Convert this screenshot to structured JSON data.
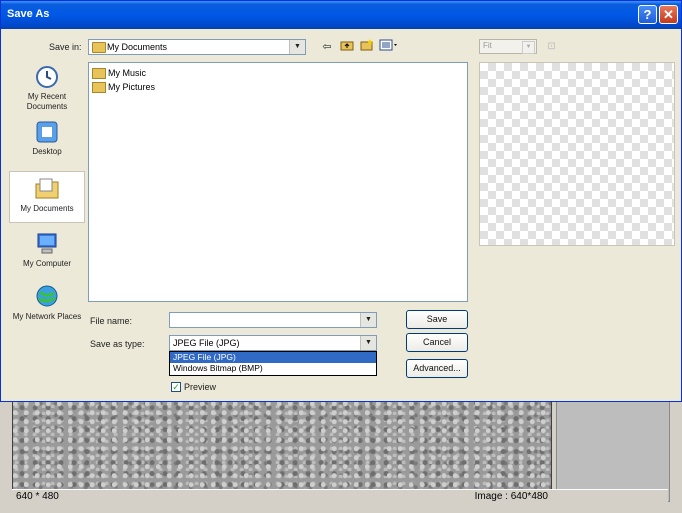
{
  "dialog": {
    "title": "Save As",
    "help_button": "?",
    "close_button": "✕"
  },
  "save_in": {
    "label": "Save in:",
    "value": "My Documents"
  },
  "toolbar": {
    "back_icon": "back-arrow-icon",
    "up_icon": "up-folder-icon",
    "new_folder_icon": "new-folder-icon",
    "views_icon": "views-menu-icon"
  },
  "places": [
    {
      "label": "My Recent Documents",
      "icon": "recent-documents-icon"
    },
    {
      "label": "Desktop",
      "icon": "desktop-icon"
    },
    {
      "label": "My Documents",
      "icon": "my-documents-icon"
    },
    {
      "label": "My Computer",
      "icon": "my-computer-icon"
    },
    {
      "label": "My Network Places",
      "icon": "network-places-icon"
    }
  ],
  "files": [
    {
      "name": "My Music"
    },
    {
      "name": "My Pictures"
    }
  ],
  "file_name": {
    "label": "File name:",
    "value": ""
  },
  "save_as_type": {
    "label": "Save as type:",
    "value": "JPEG File (JPG)",
    "options": [
      "JPEG File (JPG)",
      "Windows Bitmap (BMP)"
    ]
  },
  "buttons": {
    "save": "Save",
    "cancel": "Cancel",
    "advanced": "Advanced..."
  },
  "preview": {
    "label": "Preview",
    "checked": true,
    "zoom_value": "Fit"
  },
  "background_app": {
    "status_left": "640 * 480",
    "status_right": "Image : 640*480"
  },
  "colors": {
    "titlebar": "#0058e6",
    "selection": "#316ac5",
    "dialog_bg": "#ece9d8"
  }
}
